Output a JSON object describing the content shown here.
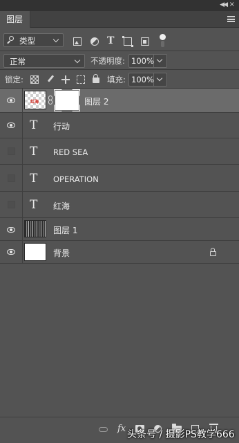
{
  "panel": {
    "tab_label": "图层"
  },
  "filter": {
    "kind_label": "类型"
  },
  "blend": {
    "mode": "正常",
    "opacity_label": "不透明度:",
    "opacity_value": "100%"
  },
  "lock": {
    "label": "锁定:",
    "fill_label": "填充:",
    "fill_value": "100%"
  },
  "layers": [
    {
      "name": "图层 2",
      "kind": "pixel-with-mask",
      "visible": true,
      "selected": true,
      "thumb_text": "红海"
    },
    {
      "name": "行动",
      "kind": "text",
      "visible": true,
      "selected": false
    },
    {
      "name": "RED SEA",
      "kind": "text",
      "visible": false,
      "selected": false
    },
    {
      "name": "OPERATION",
      "kind": "text",
      "visible": false,
      "selected": false
    },
    {
      "name": "红海",
      "kind": "text",
      "visible": false,
      "selected": false
    },
    {
      "name": "图层 1",
      "kind": "pixel",
      "visible": true,
      "selected": false
    },
    {
      "name": "背景",
      "kind": "background",
      "visible": true,
      "selected": false,
      "locked": true
    }
  ],
  "text_glyph": "T",
  "bottom": {
    "fx_label": "fx"
  },
  "watermark": "头条号 / 摄影PS教学666"
}
